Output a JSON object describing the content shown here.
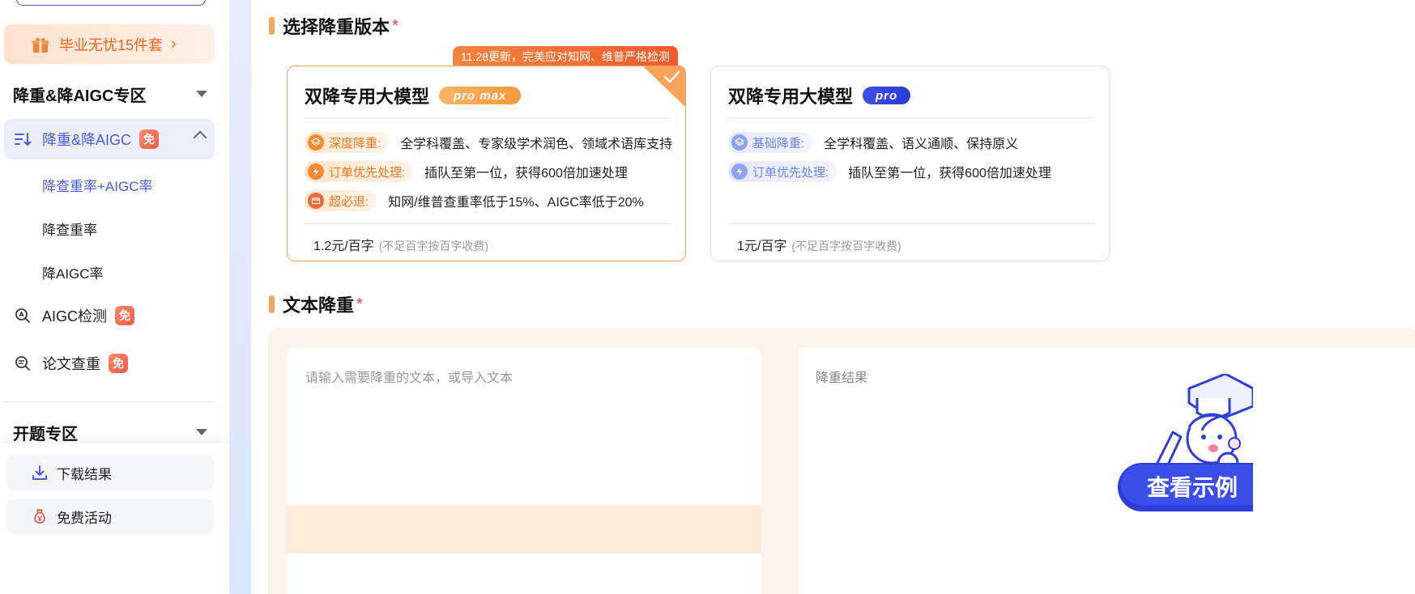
{
  "sidebar": {
    "promo_label": "毕业无忧15件套",
    "section1_title": "降重&降AIGC专区",
    "active_item": {
      "label": "降重&降AIGC",
      "badge": "免"
    },
    "sub_items": [
      {
        "label": "降查重率+AIGC率"
      },
      {
        "label": "降查重率"
      },
      {
        "label": "降AIGC率"
      }
    ],
    "items": [
      {
        "label": "AIGC检测",
        "badge": "免"
      },
      {
        "label": "论文查重",
        "badge": "免"
      }
    ],
    "section2_title": "开题专区",
    "bottom": [
      {
        "label": "下载结果"
      },
      {
        "label": "免费活动"
      }
    ]
  },
  "main": {
    "version_section": {
      "title": "选择降重版本",
      "required": "*"
    },
    "ribbon": "11.28更新，完美应对知网、维普严格检测",
    "cards": [
      {
        "name": "双降专用大模型",
        "pill": "pro max",
        "features": [
          {
            "tag": "深度降重:",
            "desc": "全学科覆盖、专家级学术润色、领域术语库支持"
          },
          {
            "tag": "订单优先处理:",
            "desc": "插队至第一位，获得600倍加速处理"
          },
          {
            "tag": "超必退:",
            "desc": "知网/维普查重率低于15%、AIGC率低于20%"
          }
        ],
        "price": "1.2元/百字",
        "price_note": "(不足百字按百字收费)"
      },
      {
        "name": "双降专用大模型",
        "pill": "pro",
        "features": [
          {
            "tag": "基础降重:",
            "desc": "全学科覆盖、语义通顺、保持原义"
          },
          {
            "tag": "订单优先处理:",
            "desc": "插队至第一位，获得600倍加速处理"
          }
        ],
        "price": "1元/百字",
        "price_note": "(不足百字按百字收费)"
      }
    ],
    "text_section": {
      "title": "文本降重",
      "required": "*"
    },
    "input_placeholder": "请输入需要降重的文本，或导入文本",
    "result_placeholder": "降重结果",
    "example_button": "查看示例"
  },
  "colors": {
    "accent_blue": "#4b5be0",
    "accent_orange": "#f7a35c",
    "required_red": "#ee3b3b"
  }
}
